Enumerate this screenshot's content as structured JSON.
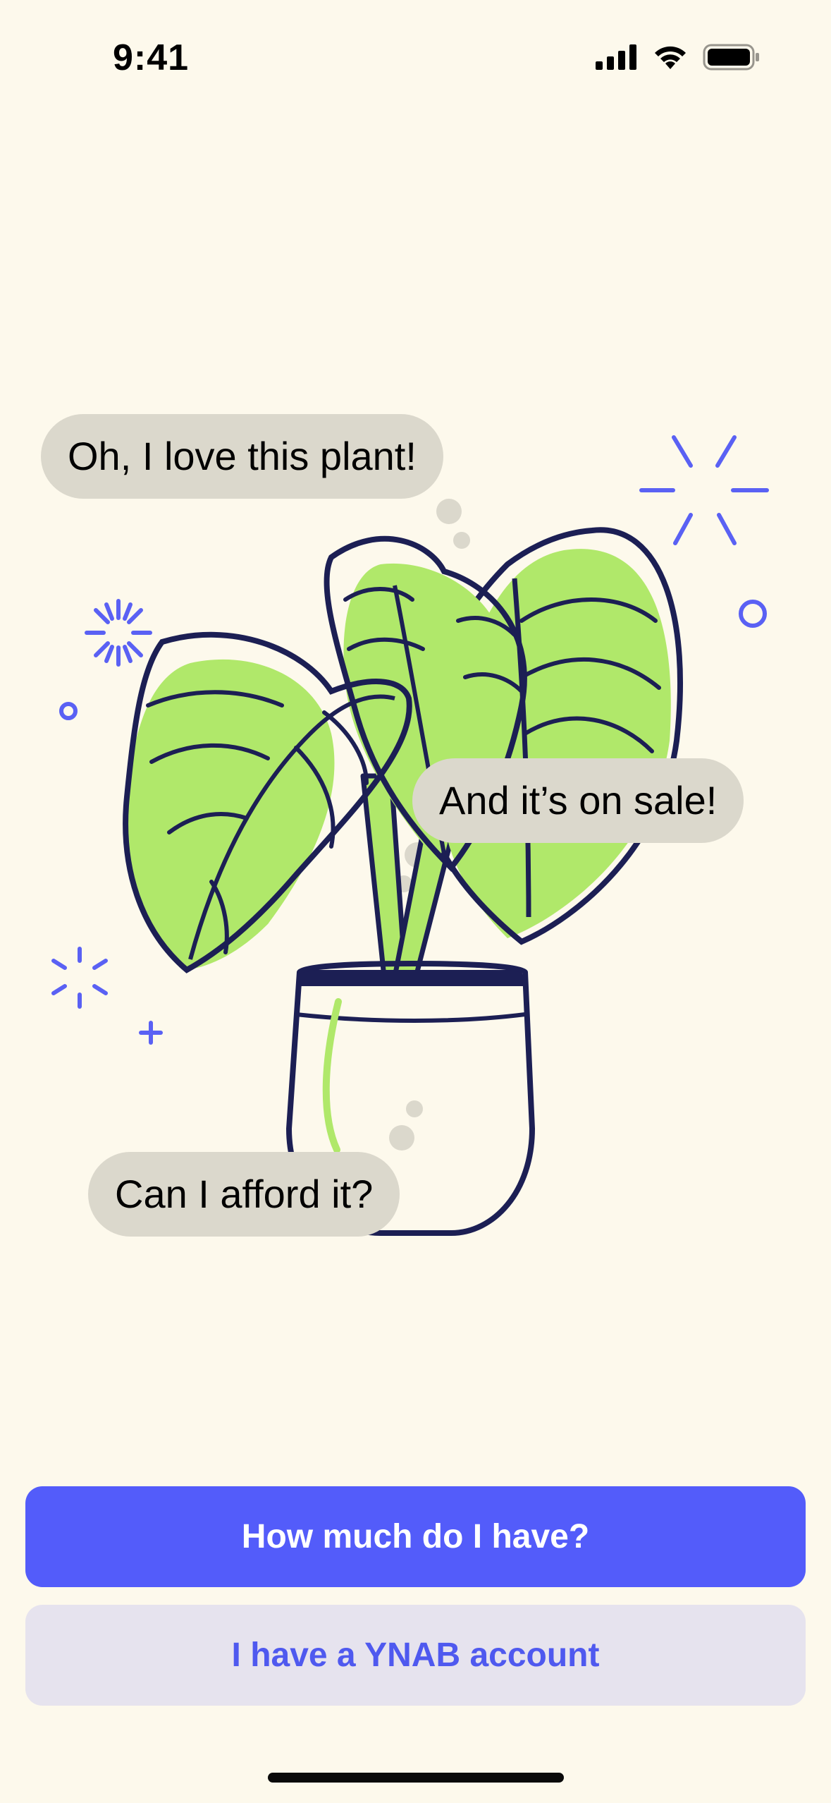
{
  "status_bar": {
    "time": "9:41"
  },
  "bubbles": {
    "first": "Oh, I love this plant!",
    "second": "And it’s on sale!",
    "third": "Can I afford it?"
  },
  "buttons": {
    "primary": "How much do I have?",
    "secondary": "I have a YNAB account"
  },
  "colors": {
    "background": "#fdf9ec",
    "accent": "#535cfa",
    "leaf_green": "#b0e86a",
    "outline_navy": "#1c1f54",
    "bubble_gray": "#dbd8cc"
  }
}
